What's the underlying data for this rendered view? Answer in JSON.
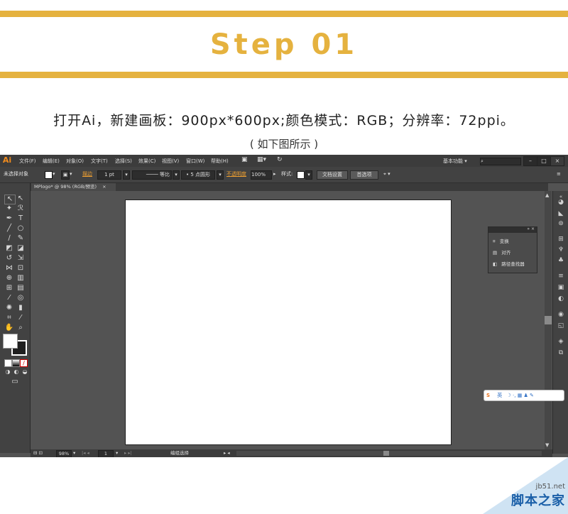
{
  "header": {
    "title": "Step 01"
  },
  "instruction": "打开Ai，新建画板：900px*600px;颜色模式：RGB；分辨率：72ppi。",
  "caption": "( 如下图所示 )",
  "app": {
    "logo": "Ai",
    "menus": [
      "文件(F)",
      "编辑(E)",
      "对象(O)",
      "文字(T)",
      "选择(S)",
      "效果(C)",
      "视图(V)",
      "窗口(W)",
      "帮助(H)"
    ],
    "workspace": "基本功能",
    "window_buttons": [
      "–",
      "□",
      "×"
    ],
    "control_bar": {
      "selection_status": "未选择对象",
      "stroke_label": "描边",
      "stroke_width": "1 pt",
      "stroke_profile": "等比",
      "brush": "5 点圆形",
      "opacity_label": "不透明度",
      "opacity_value": "100%",
      "style_label": "样式",
      "doc_setup": "文档设置",
      "preferences": "首选项"
    },
    "document_tab": "MPlogo* @ 98% (RGB/预览)",
    "panel": {
      "items": [
        "变换",
        "对齐",
        "路径查找器"
      ]
    },
    "ime_label": "英",
    "status": {
      "zoom": "98%",
      "page": "1",
      "selection_tool": "编组选择"
    }
  },
  "watermark": {
    "site": "jb51.net",
    "name": "脚本之家"
  },
  "colors": {
    "accent": "#e5b23f",
    "ai_logo": "#f08b1d",
    "ui_dark": "#3c3c3c",
    "canvas": "#535353"
  }
}
